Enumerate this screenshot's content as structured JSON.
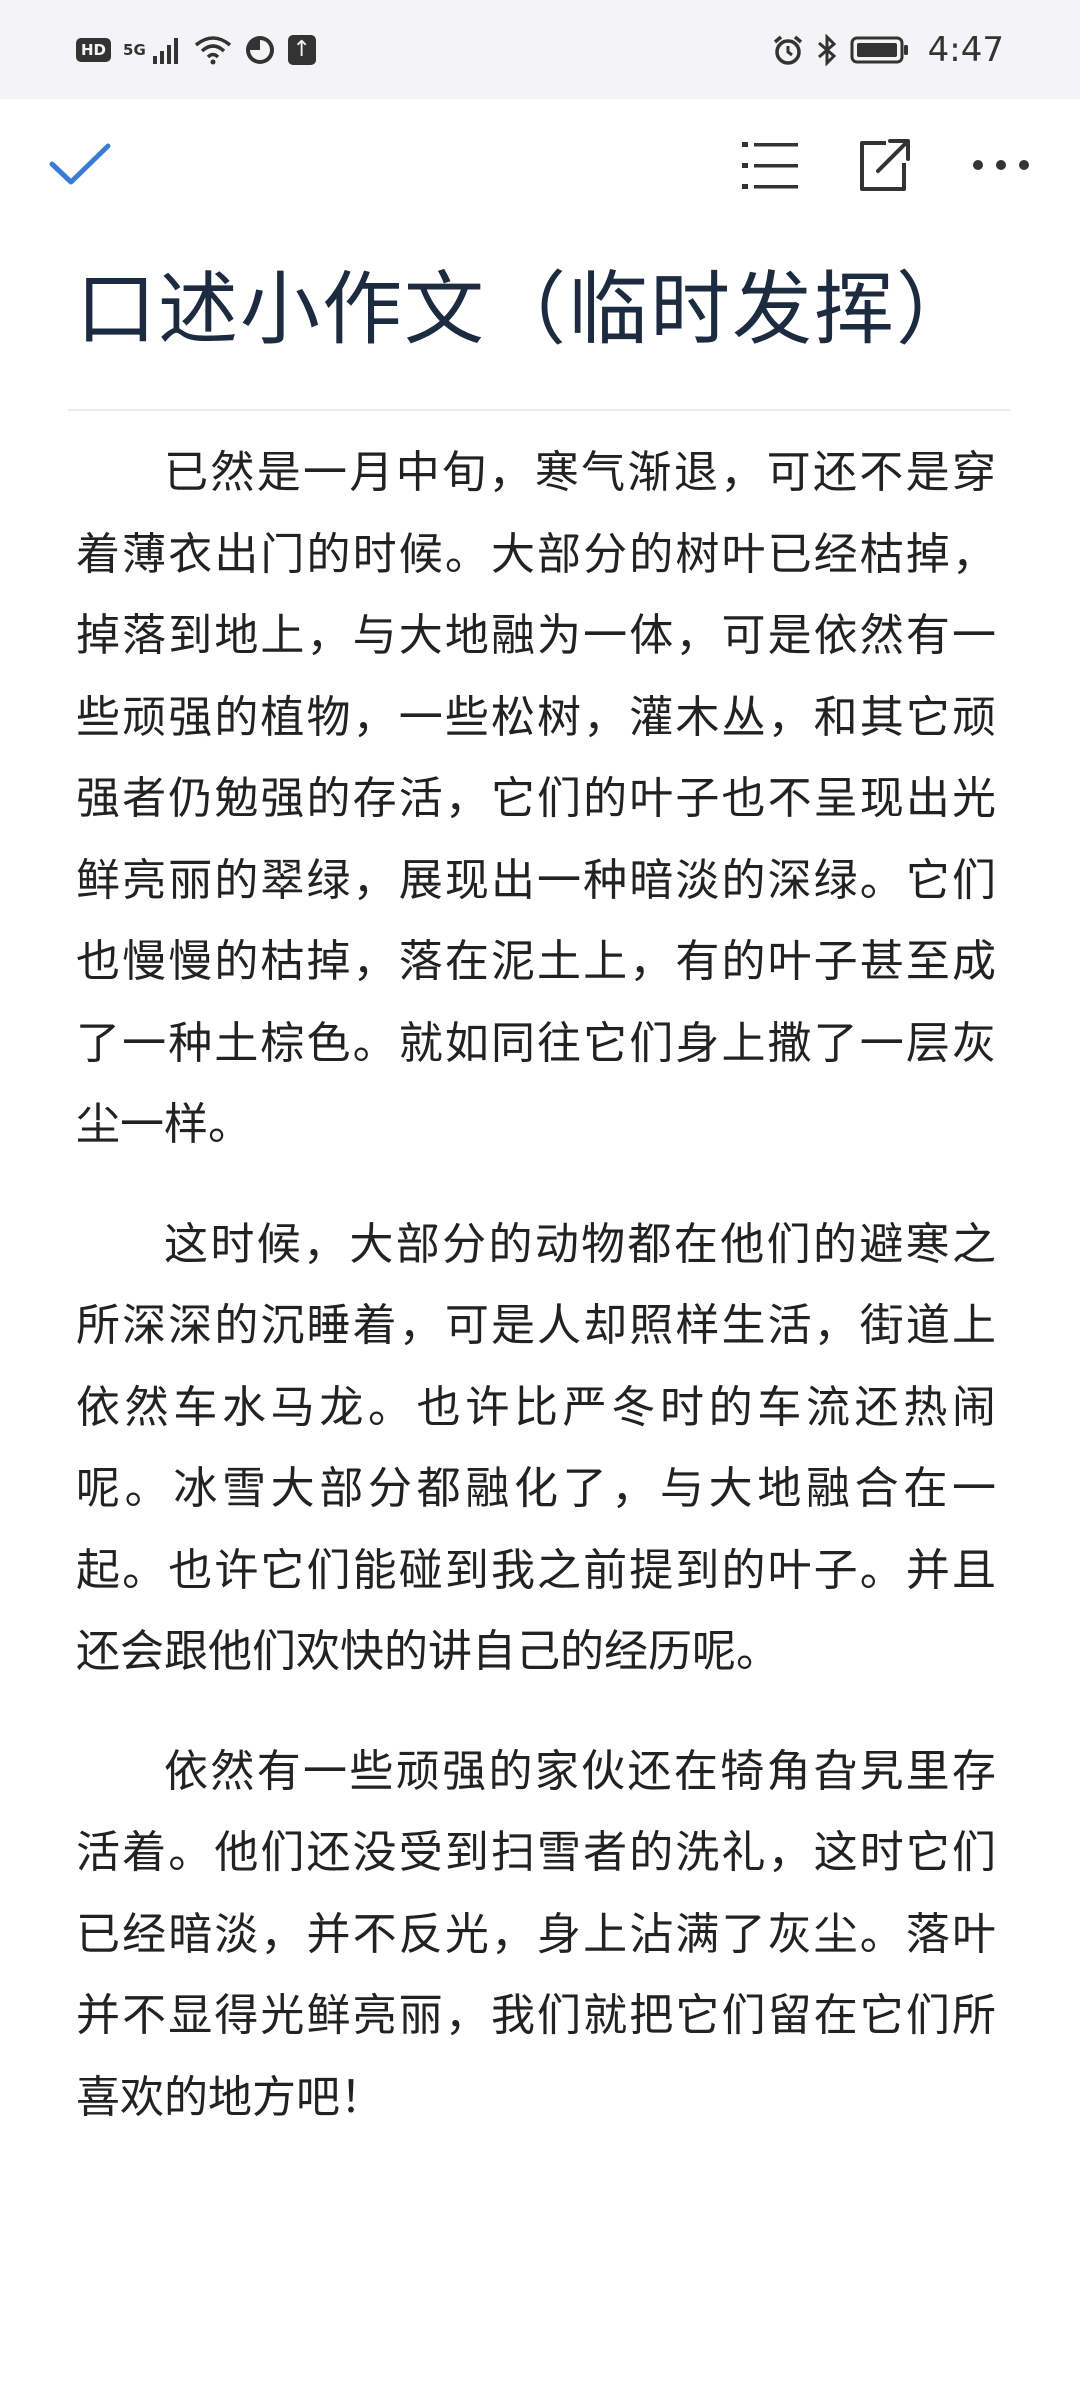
{
  "status_bar": {
    "hd": "HD",
    "network": "5G",
    "time": "4:47"
  },
  "toolbar": {
    "done_icon": "check-icon",
    "outline_icon": "list-outline-icon",
    "share_icon": "share-icon",
    "more_icon": "more-dots-icon"
  },
  "document": {
    "title": "口述小作文（临时发挥）",
    "paragraphs": [
      "已然是一月中旬，寒气渐退，可还不是穿着薄衣出门的时候。大部分的树叶已经枯掉，掉落到地上，与大地融为一体，可是依然有一些顽强的植物，一些松树，灌木丛，和其它顽强者仍勉强的存活，它们的叶子也不呈现出光鲜亮丽的翠绿，展现出一种暗淡的深绿。它们也慢慢的枯掉，落在泥土上，有的叶子甚至成了一种土棕色。就如同往它们身上撒了一层灰尘一样。",
      "这时候，大部分的动物都在他们的避寒之所深深的沉睡着，可是人却照样生活，街道上依然车水马龙。也许比严冬时的车流还热闹呢。冰雪大部分都融化了，与大地融合在一起。也许它们能碰到我之前提到的叶子。并且还会跟他们欢快的讲自己的经历呢。",
      "依然有一些顽强的家伙还在犄角旮旯里存活着。他们还没受到扫雪者的洗礼，这时它们已经暗淡，并不反光，身上沾满了灰尘。落叶并不显得光鲜亮丽，我们就把它们留在它们所喜欢的地方吧！"
    ]
  },
  "colors": {
    "accent": "#3a7bd5",
    "title": "#1c2b3f",
    "status_bg": "#f4f4f6"
  }
}
